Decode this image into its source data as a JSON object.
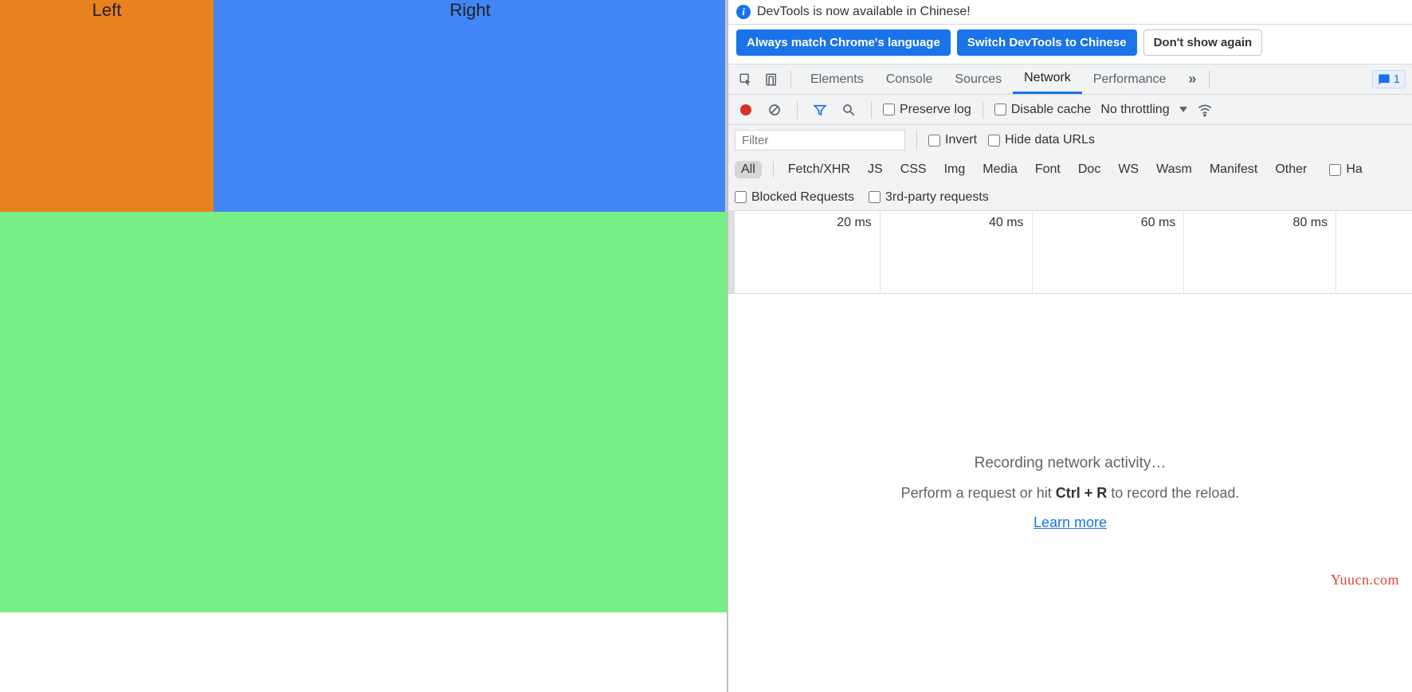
{
  "page": {
    "left_label": "Left",
    "right_label": "Right"
  },
  "banner": {
    "text": "DevTools is now available in Chinese!",
    "btn_always": "Always match Chrome's language",
    "btn_switch": "Switch DevTools to Chinese",
    "btn_dont": "Don't show again"
  },
  "tabs": {
    "items": [
      "Elements",
      "Console",
      "Sources",
      "Network",
      "Performance"
    ],
    "active": "Network",
    "issues_count": "1"
  },
  "toolbar": {
    "preserve_log": "Preserve log",
    "disable_cache": "Disable cache",
    "throttling": "No throttling"
  },
  "filters": {
    "placeholder": "Filter",
    "invert": "Invert",
    "hide_data_urls": "Hide data URLs",
    "types": [
      "All",
      "Fetch/XHR",
      "JS",
      "CSS",
      "Img",
      "Media",
      "Font",
      "Doc",
      "WS",
      "Wasm",
      "Manifest",
      "Other"
    ],
    "active_type": "All",
    "has_blocked_cookies_partial": "Ha",
    "blocked_requests": "Blocked Requests",
    "third_party": "3rd-party requests"
  },
  "timeline": {
    "ticks": [
      "20 ms",
      "40 ms",
      "60 ms",
      "80 ms"
    ]
  },
  "empty": {
    "recording": "Recording network activity…",
    "perform_pre": "Perform a request or hit ",
    "shortcut": "Ctrl + R",
    "perform_post": " to record the reload.",
    "learn_more": "Learn more"
  },
  "watermark": "Yuucn.com"
}
